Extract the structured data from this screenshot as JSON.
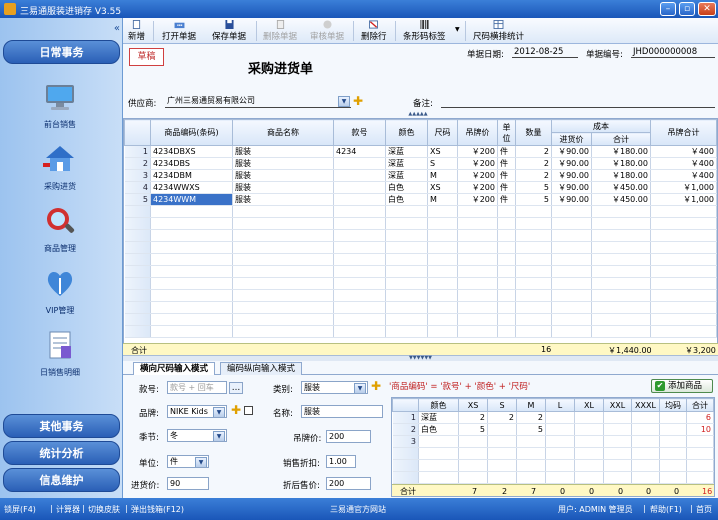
{
  "app": {
    "title": "三易通服装进销存 V3.55"
  },
  "sidebar": {
    "header_daily": "日常事务",
    "items": [
      {
        "label": "前台销售",
        "icon": "monitor-icon"
      },
      {
        "label": "采购进货",
        "icon": "house-icon"
      },
      {
        "label": "商品管理",
        "icon": "magnifier-icon"
      },
      {
        "label": "VIP管理",
        "icon": "heart-icon"
      },
      {
        "label": "日销售明细",
        "icon": "document-icon"
      }
    ],
    "header_other": "其他事务",
    "header_stats": "统计分析",
    "header_info": "信息维护"
  },
  "toolbar": {
    "new": "新增",
    "open": "打开单据",
    "save": "保存单据",
    "delete_doc": "删除单据",
    "audit": "审核单据",
    "delete_row": "删除行",
    "barcode": "条形码标签",
    "size_stats": "尺码横排统计"
  },
  "doc": {
    "status": "草稿",
    "title": "采购进货单",
    "date_label": "单据日期:",
    "date": "2012-08-25",
    "no_label": "单据编号:",
    "no": "JHD000000008",
    "supplier_label": "供应商:",
    "supplier": "广州三易通贸易有限公司",
    "remark_label": "备注:"
  },
  "grid": {
    "headers": [
      "商品编码(条码)",
      "商品名称",
      "款号",
      "颜色",
      "尺码",
      "吊牌价",
      "单位",
      "数量",
      "成本",
      "进货价",
      "合计",
      "吊牌合计"
    ],
    "rows": [
      {
        "n": "1",
        "code": "4234DBXS",
        "name": "服装",
        "style": "4234",
        "color": "深蓝",
        "size": "XS",
        "tag": "￥200",
        "unit": "件",
        "qty": "2",
        "price": "￥90.00",
        "sum": "￥180.00",
        "tagsum": "￥400"
      },
      {
        "n": "2",
        "code": "4234DBS",
        "name": "服装",
        "style": "",
        "color": "深蓝",
        "size": "S",
        "tag": "￥200",
        "unit": "件",
        "qty": "2",
        "price": "￥90.00",
        "sum": "￥180.00",
        "tagsum": "￥400"
      },
      {
        "n": "3",
        "code": "4234DBM",
        "name": "服装",
        "style": "",
        "color": "深蓝",
        "size": "M",
        "tag": "￥200",
        "unit": "件",
        "qty": "2",
        "price": "￥90.00",
        "sum": "￥180.00",
        "tagsum": "￥400"
      },
      {
        "n": "4",
        "code": "4234WWXS",
        "name": "服装",
        "style": "",
        "color": "白色",
        "size": "XS",
        "tag": "￥200",
        "unit": "件",
        "qty": "5",
        "price": "￥90.00",
        "sum": "￥450.00",
        "tagsum": "￥1,000"
      },
      {
        "n": "5",
        "code": "4234WWM",
        "name": "服装",
        "style": "",
        "color": "白色",
        "size": "M",
        "tag": "￥200",
        "unit": "件",
        "qty": "5",
        "price": "￥90.00",
        "sum": "￥450.00",
        "tagsum": "￥1,000"
      }
    ],
    "total_label": "合计",
    "total_qty": "16",
    "total_sum": "￥1,440.00",
    "total_tag": "￥3,200"
  },
  "tabs": {
    "horizontal": "横向尺码输入模式",
    "vertical": "编码纵向输入模式"
  },
  "form": {
    "style_label": "款号:",
    "style_placeholder": "款号 + 回车",
    "brand_label": "品牌:",
    "brand": "NIKE Kids",
    "season_label": "季节:",
    "season": "冬",
    "unit_label": "单位:",
    "unit": "件",
    "cost_label": "进货价:",
    "cost": "90",
    "cat_label": "类别:",
    "cat": "服装",
    "name_label": "名称:",
    "name": "服装",
    "tag_label": "吊牌价:",
    "tag": "200",
    "disc_label": "销售折扣:",
    "disc": "1.00",
    "after_label": "折后售价:",
    "after": "200",
    "formula": "'商品编码' = '款号' + '颜色' + '尺码'",
    "add_button": "添加商品"
  },
  "sizegrid": {
    "headers": [
      "颜色",
      "XS",
      "S",
      "M",
      "L",
      "XL",
      "XXL",
      "XXXL",
      "均码",
      "合计"
    ],
    "rows": [
      {
        "n": "1",
        "color": "深蓝",
        "v": [
          "2",
          "2",
          "2",
          "",
          "",
          "",
          "",
          "",
          "6"
        ]
      },
      {
        "n": "2",
        "color": "白色",
        "v": [
          "5",
          "",
          "5",
          "",
          "",
          "",
          "",
          "",
          "10"
        ]
      },
      {
        "n": "3",
        "color": "",
        "v": [
          "",
          "",
          "",
          "",
          "",
          "",
          "",
          "",
          ""
        ]
      }
    ],
    "total_label": "合计",
    "totals": [
      "7",
      "2",
      "7",
      "0",
      "0",
      "0",
      "0",
      "0",
      "16"
    ]
  },
  "status": {
    "lock": "锁屏(F4)",
    "calc": "计算器",
    "skin": "切换皮肤",
    "cash": "弹出钱箱(F12)",
    "site": "三易通官方网站",
    "user": "用户: ADMIN 管理员",
    "help": "帮助(F1)",
    "home": "首页"
  }
}
